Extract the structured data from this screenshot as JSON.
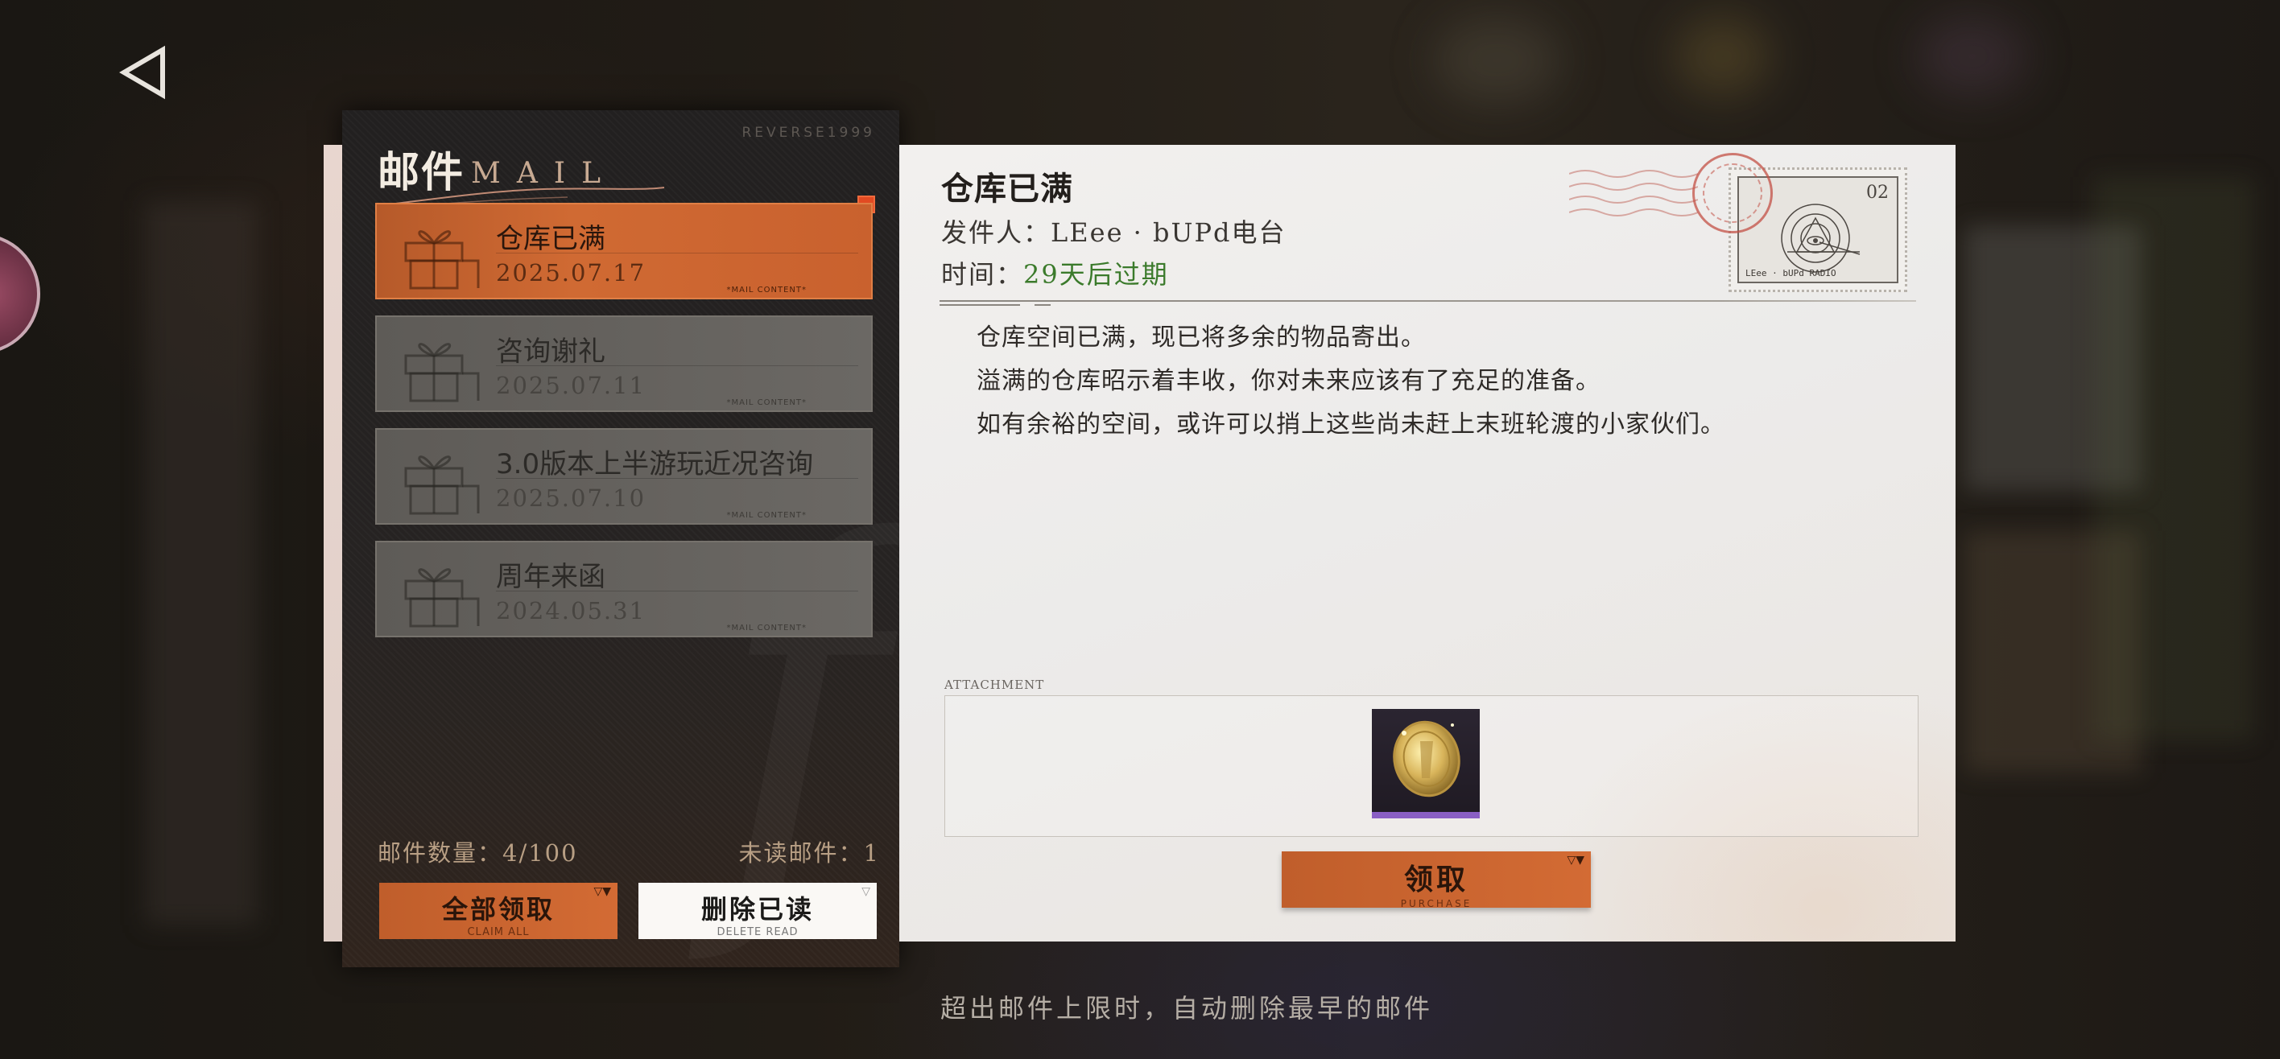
{
  "panel": {
    "title": "邮件",
    "title_en": "MAIL",
    "brand": "REVERSE1999",
    "mail_count": "邮件数量：4/100",
    "unread_count": "未读邮件：1",
    "mail_tag": "*MAIL CONTENT*",
    "mails": [
      {
        "title": "仓库已满",
        "date": "2025.07.17",
        "state": "active"
      },
      {
        "title": "咨询谢礼",
        "date": "2025.07.11",
        "state": "read"
      },
      {
        "title": "3.0版本上半游玩近况咨询",
        "date": "2025.07.10",
        "state": "read"
      },
      {
        "title": "周年来函",
        "date": "2024.05.31",
        "state": "read"
      }
    ],
    "claim_all": {
      "label": "全部领取",
      "sub": "CLAIM ALL"
    },
    "delete_read": {
      "label": "删除已读",
      "sub": "DELETE READ"
    }
  },
  "letter": {
    "title": "仓库已满",
    "sender_label": "发件人：",
    "sender": "LEee · bUPd电台",
    "time_label": "时间：",
    "expiry": "29天后过期",
    "body": [
      "仓库空间已满，现已将多余的物品寄出。",
      "溢满的仓库昭示着丰收，你对未来应该有了充足的准备。",
      "如有余裕的空间，或许可以捎上这些尚未赶上末班轮渡的小家伙们。"
    ],
    "stamp": {
      "number": "02",
      "caption": "LEee · bUPd RADIO"
    },
    "attachment_label": "ATTACHMENT",
    "attachment_item_icon": "gold-coin-icon",
    "claim": {
      "label": "领取",
      "sub": "PURCHASE"
    }
  },
  "footer_hint": "超出邮件上限时，自动删除最早的邮件",
  "colors": {
    "accent_orange": "#d06a33",
    "expiry_green": "#3b7a2b",
    "unread_red": "#e24a22"
  }
}
